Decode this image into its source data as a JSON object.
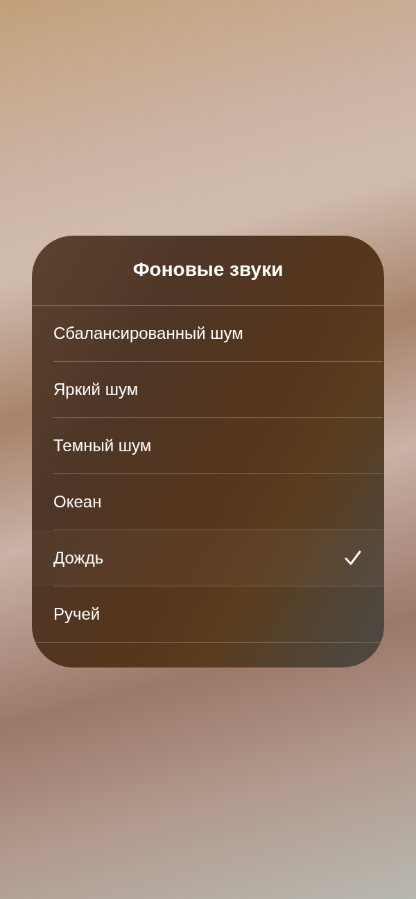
{
  "sheet": {
    "title": "Фоновые звуки",
    "options": [
      {
        "label": "Сбалансированный шум",
        "selected": false
      },
      {
        "label": "Яркий шум",
        "selected": false
      },
      {
        "label": "Темный шум",
        "selected": false
      },
      {
        "label": "Океан",
        "selected": false
      },
      {
        "label": "Дождь",
        "selected": true
      },
      {
        "label": "Ручей",
        "selected": false
      }
    ]
  }
}
